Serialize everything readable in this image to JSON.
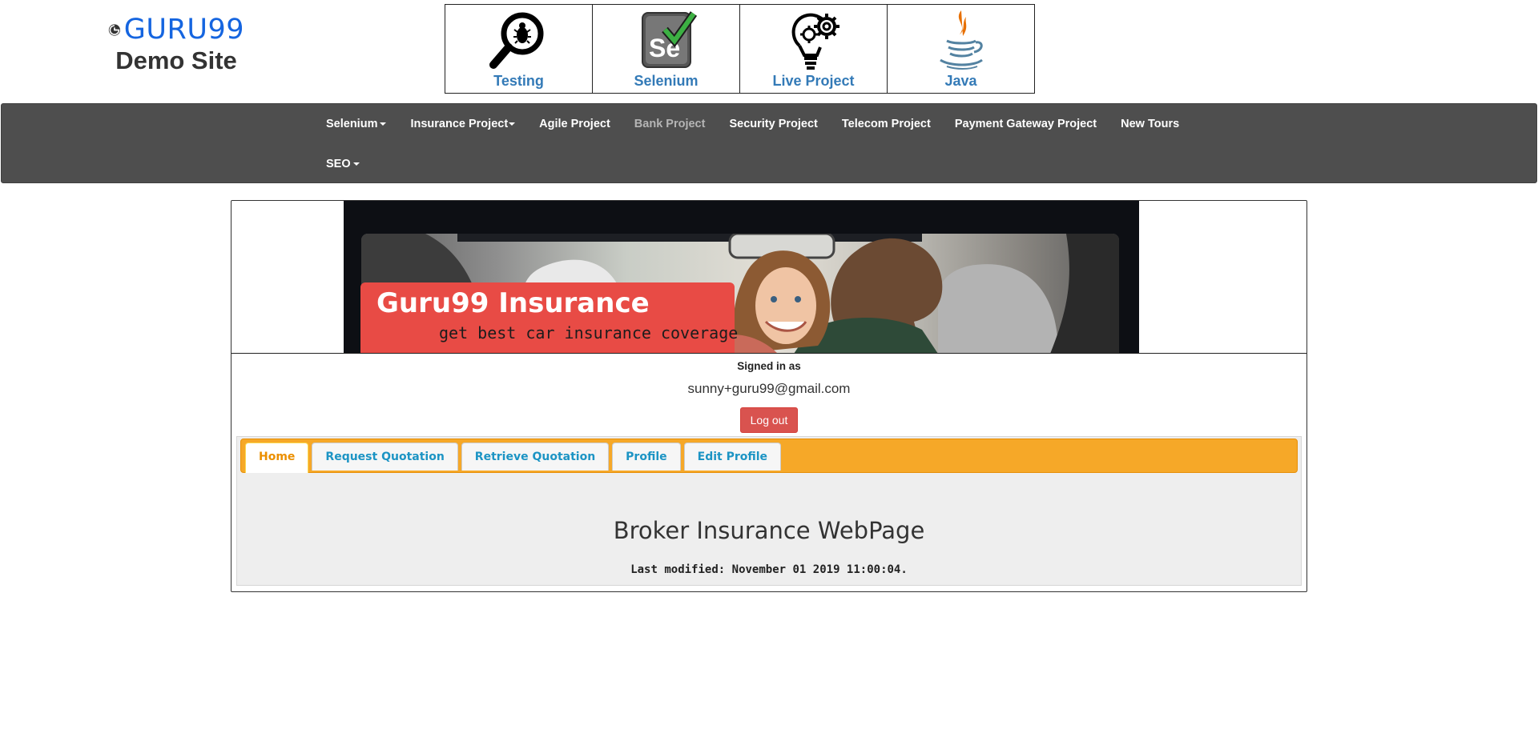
{
  "header": {
    "brand_name": "GURU99",
    "brand_subtitle": "Demo Site",
    "icons": [
      {
        "label": "Testing",
        "icon": "magnifier-bug-icon"
      },
      {
        "label": "Selenium",
        "icon": "selenium-se-icon"
      },
      {
        "label": "Live Project",
        "icon": "lightbulb-gears-icon"
      },
      {
        "label": "Java",
        "icon": "java-cup-icon"
      }
    ]
  },
  "navbar": {
    "items": [
      {
        "label": "Selenium",
        "dropdown": true
      },
      {
        "label": "Insurance Project",
        "dropdown": true
      },
      {
        "label": "Agile Project",
        "dropdown": false
      },
      {
        "label": "Bank Project",
        "dropdown": false,
        "active": true
      },
      {
        "label": "Security Project",
        "dropdown": false
      },
      {
        "label": "Telecom Project",
        "dropdown": false
      },
      {
        "label": "Payment Gateway Project",
        "dropdown": false
      },
      {
        "label": "New Tours",
        "dropdown": false
      },
      {
        "label": "SEO",
        "dropdown": true
      }
    ]
  },
  "banner": {
    "title": "Guru99 Insurance",
    "subtitle": "get best car insurance coverage"
  },
  "account": {
    "signed_in_label": "Signed in as",
    "email": "sunny+guru99@gmail.com",
    "logout_label": "Log out"
  },
  "tabs": [
    {
      "label": "Home",
      "active": true
    },
    {
      "label": "Request Quotation",
      "active": false
    },
    {
      "label": "Retrieve Quotation",
      "active": false
    },
    {
      "label": "Profile",
      "active": false
    },
    {
      "label": "Edit Profile",
      "active": false
    }
  ],
  "content": {
    "heading": "Broker Insurance WebPage",
    "last_modified": "Last modified: November 01 2019 11:00:04."
  },
  "colors": {
    "navbar_bg": "#4e4e4e",
    "link_blue": "#337ab7",
    "brand_blue": "#1565e0",
    "tab_strip": "#f6a828",
    "logout_red": "#d9534f",
    "banner_red": "#e84b45"
  }
}
